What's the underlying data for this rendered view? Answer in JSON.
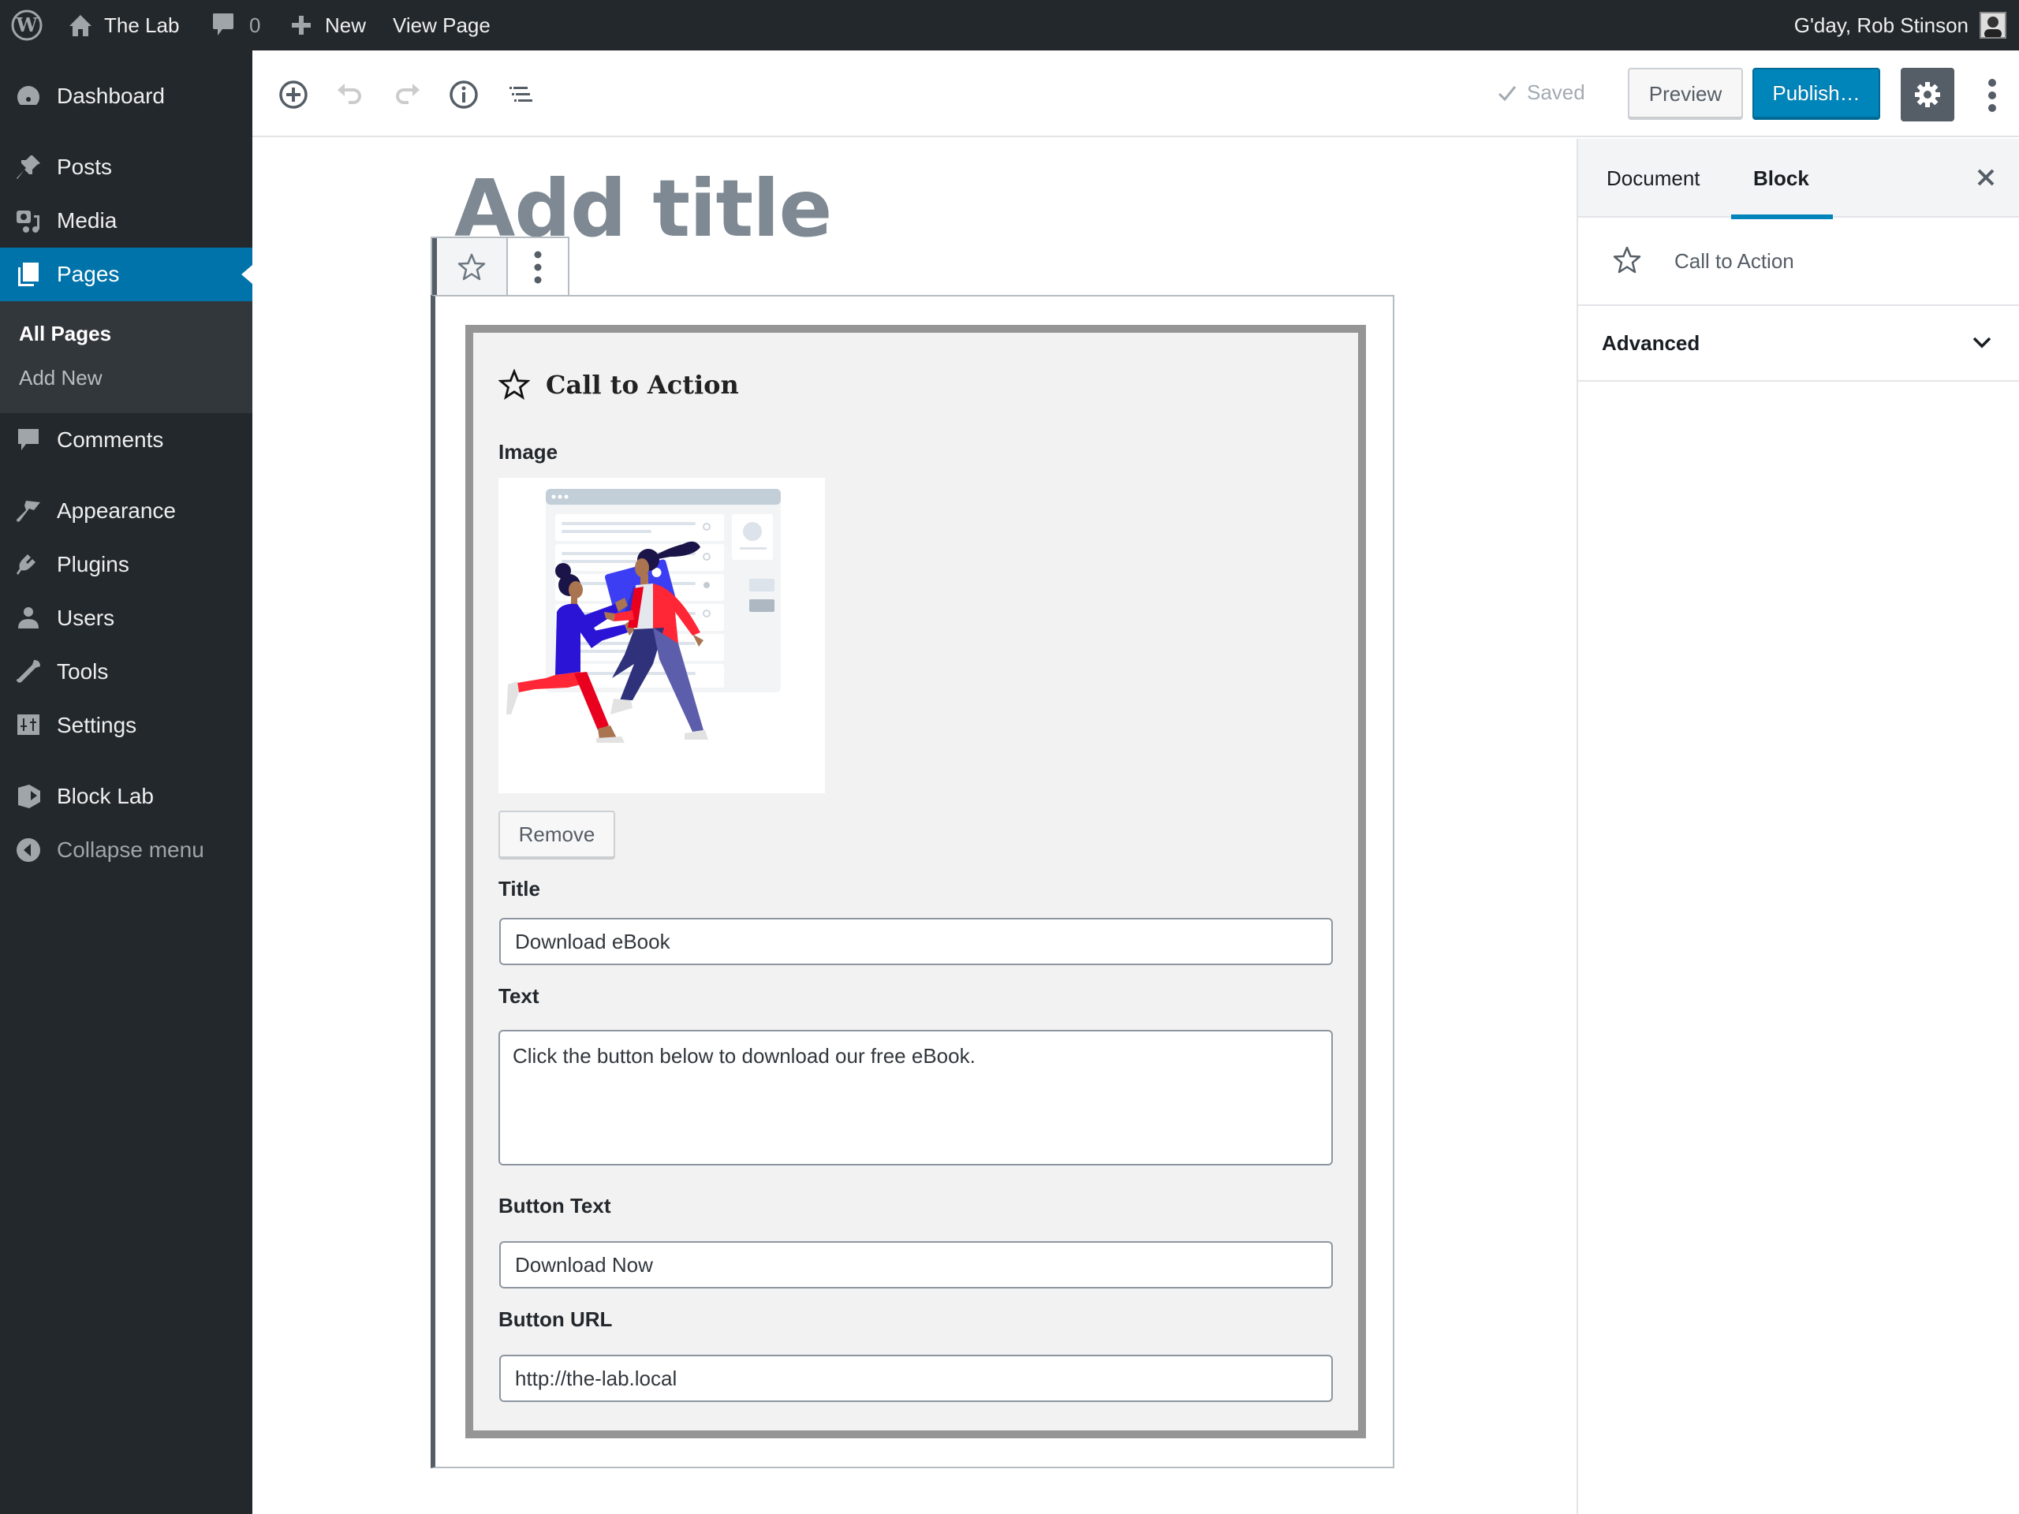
{
  "admin_bar": {
    "site_name": "The Lab",
    "comments_count": "0",
    "new_label": "New",
    "view_page_label": "View Page",
    "greeting": "G'day, Rob Stinson"
  },
  "admin_menu": {
    "items": [
      {
        "label": "Dashboard",
        "icon": "dashboard-icon"
      },
      {
        "label": "Posts",
        "icon": "pin-icon"
      },
      {
        "label": "Media",
        "icon": "media-icon"
      },
      {
        "label": "Pages",
        "icon": "pages-icon",
        "current": true
      },
      {
        "label": "Comments",
        "icon": "comments-icon"
      },
      {
        "label": "Appearance",
        "icon": "brush-icon"
      },
      {
        "label": "Plugins",
        "icon": "plug-icon"
      },
      {
        "label": "Users",
        "icon": "user-icon"
      },
      {
        "label": "Tools",
        "icon": "wrench-icon"
      },
      {
        "label": "Settings",
        "icon": "sliders-icon"
      },
      {
        "label": "Block Lab",
        "icon": "block-lab-icon"
      },
      {
        "label": "Collapse menu",
        "icon": "collapse-icon"
      }
    ],
    "submenu": [
      {
        "label": "All Pages",
        "current": true
      },
      {
        "label": "Add New"
      }
    ]
  },
  "editor_header": {
    "saved_label": "Saved",
    "preview_label": "Preview",
    "publish_label": "Publish…"
  },
  "editor": {
    "title_placeholder": "Add title",
    "block": {
      "name": "Call to Action",
      "fields": {
        "image_label": "Image",
        "remove_label": "Remove",
        "title_label": "Title",
        "title_value": "Download eBook",
        "text_label": "Text",
        "text_value": "Click the button below to download our free eBook.",
        "button_text_label": "Button Text",
        "button_text_value": "Download Now",
        "button_url_label": "Button URL",
        "button_url_value": "http://the-lab.local"
      }
    }
  },
  "sidebar": {
    "tabs": [
      {
        "label": "Document"
      },
      {
        "label": "Block",
        "active": true
      }
    ],
    "block_card_title": "Call to Action",
    "panels": [
      {
        "title": "Advanced",
        "expanded": false
      }
    ]
  },
  "colors": {
    "admin_dark": "#23282d",
    "accent": "#0073aa",
    "publish": "#0085ba",
    "frame_gray": "#959595"
  }
}
